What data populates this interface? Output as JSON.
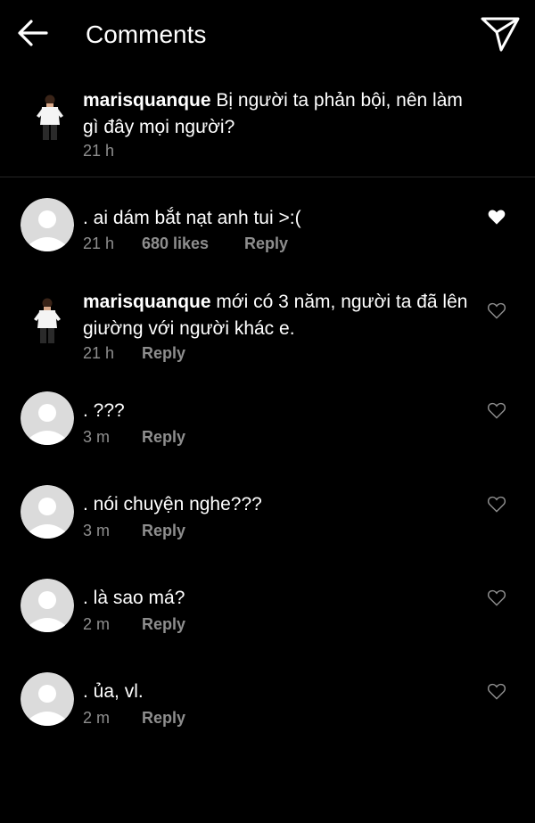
{
  "header": {
    "title": "Comments",
    "back_icon": "arrow-left-icon",
    "share_icon": "paper-plane-icon"
  },
  "caption": {
    "username": "marisquanque",
    "text": "Bị người ta phản bội, nên làm gì đây mọi người?",
    "time": "21 h"
  },
  "comments": [
    {
      "username": "",
      "text": ". ai dám bắt nạt anh tui >:(",
      "time": "21 h",
      "likes": "680 likes",
      "reply": "Reply",
      "liked": true
    },
    {
      "username": "marisquanque",
      "text": "mới có 3 năm, người ta đã lên giường với người khác e.",
      "time": "21 h",
      "likes": "",
      "reply": "Reply",
      "liked": false
    },
    {
      "username": "",
      "text": ". ???",
      "time": "3 m",
      "likes": "",
      "reply": "Reply",
      "liked": false
    },
    {
      "username": "",
      "text": ". nói chuyện nghe???",
      "time": "3 m",
      "likes": "",
      "reply": "Reply",
      "liked": false
    },
    {
      "username": "",
      "text": ". là sao má?",
      "time": "2 m",
      "likes": "",
      "reply": "Reply",
      "liked": false
    },
    {
      "username": "",
      "text": ". ủa, vl.",
      "time": "2 m",
      "likes": "",
      "reply": "Reply",
      "liked": false
    }
  ],
  "colors": {
    "background": "#000000",
    "text": "#ffffff",
    "secondary_text": "#8e8e8e",
    "divider": "#262626",
    "default_avatar_bg": "#dbdbdb"
  }
}
